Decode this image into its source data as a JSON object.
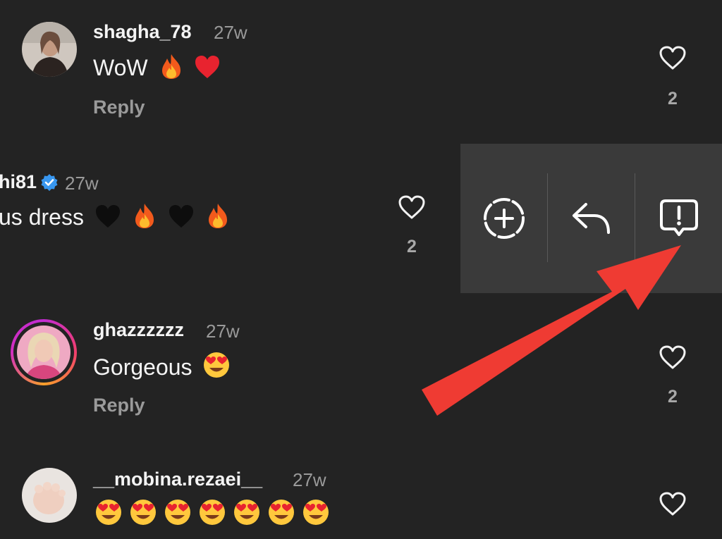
{
  "comments": [
    {
      "username": "shagha_78",
      "time": "27w",
      "text": "WoW",
      "emojis": [
        "fire",
        "heart"
      ],
      "reply_label": "Reply",
      "likes": "2"
    },
    {
      "username": "hi81",
      "time": "27w",
      "text": "us dress",
      "emojis": [
        "black-heart",
        "fire",
        "black-heart",
        "fire"
      ],
      "verified": true,
      "likes": "2"
    },
    {
      "username": "ghazzzzzz",
      "time": "27w",
      "text": "Gorgeous",
      "emojis": [
        "heart-eyes"
      ],
      "reply_label": "Reply",
      "likes": "2"
    },
    {
      "username": "__mobina.rezaei__",
      "time": "27w",
      "text": "",
      "emojis": [
        "heart-eyes",
        "heart-eyes",
        "heart-eyes",
        "heart-eyes",
        "heart-eyes",
        "heart-eyes",
        "heart-eyes"
      ]
    }
  ],
  "action_tray": {
    "actions": [
      "add-icon",
      "reply-arrow-icon",
      "report-icon"
    ]
  },
  "annotation": {
    "arrow_color": "#ef3b33"
  },
  "colors": {
    "background": "#232323",
    "tray": "#3a3a3a",
    "muted_text": "#9a9a9a",
    "verified": "#3897f0"
  }
}
